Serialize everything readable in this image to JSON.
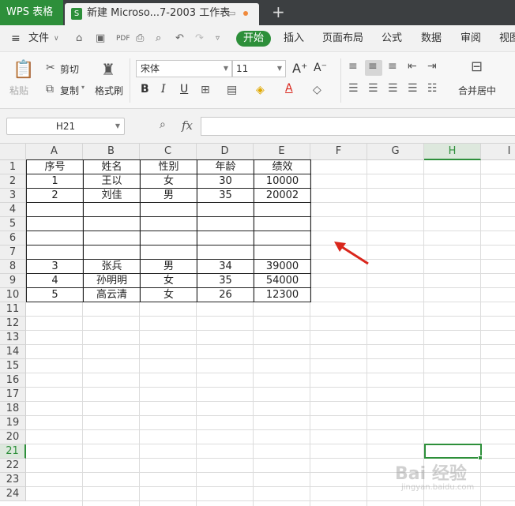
{
  "app": {
    "name": "WPS 表格",
    "doc_tab_title": "新建 Microso...7-2003 工作表",
    "doc_icon_letter": "S",
    "new_tab_symbol": "+"
  },
  "menu": {
    "file": "文件",
    "tabs": [
      "开始",
      "插入",
      "页面布局",
      "公式",
      "数据",
      "审阅",
      "视图"
    ]
  },
  "ribbon": {
    "paste": "粘贴",
    "cut": "剪切",
    "copy": "复制",
    "format_painter": "格式刷",
    "font_name": "宋体",
    "font_size": "11",
    "bold": "B",
    "italic": "I",
    "underline": "U",
    "font_color_letter": "A",
    "increase_font": "A⁺",
    "decrease_font": "A⁻",
    "merge_center": "合并居中"
  },
  "formula_bar": {
    "name_box": "H21",
    "fx": "fx",
    "formula_value": ""
  },
  "columns": [
    "A",
    "B",
    "C",
    "D",
    "E",
    "F",
    "G",
    "H",
    "I"
  ],
  "selected_column": "H",
  "rows": [
    "1",
    "2",
    "3",
    "4",
    "5",
    "6",
    "7",
    "8",
    "9",
    "10",
    "11",
    "12",
    "13",
    "14",
    "15",
    "16",
    "17",
    "18",
    "19",
    "20",
    "21",
    "22",
    "23",
    "24"
  ],
  "selected_row": "21",
  "table": {
    "headers": [
      "序号",
      "姓名",
      "性别",
      "年龄",
      "绩效"
    ],
    "rows": [
      [
        "1",
        "王以",
        "女",
        "30",
        "10000"
      ],
      [
        "2",
        "刘佳",
        "男",
        "35",
        "20002"
      ],
      [
        "",
        "",
        "",
        "",
        ""
      ],
      [
        "",
        "",
        "",
        "",
        ""
      ],
      [
        "",
        "",
        "",
        "",
        ""
      ],
      [
        "",
        "",
        "",
        "",
        ""
      ],
      [
        "3",
        "张兵",
        "男",
        "34",
        "39000"
      ],
      [
        "4",
        "孙明明",
        "女",
        "35",
        "54000"
      ],
      [
        "5",
        "高云清",
        "女",
        "26",
        "12300"
      ]
    ]
  },
  "colors": {
    "accent": "#2d8f3a",
    "arrow": "#d9261c"
  },
  "watermark": {
    "brand": "Bai 经验",
    "url": "jingyan.baidu.com"
  }
}
